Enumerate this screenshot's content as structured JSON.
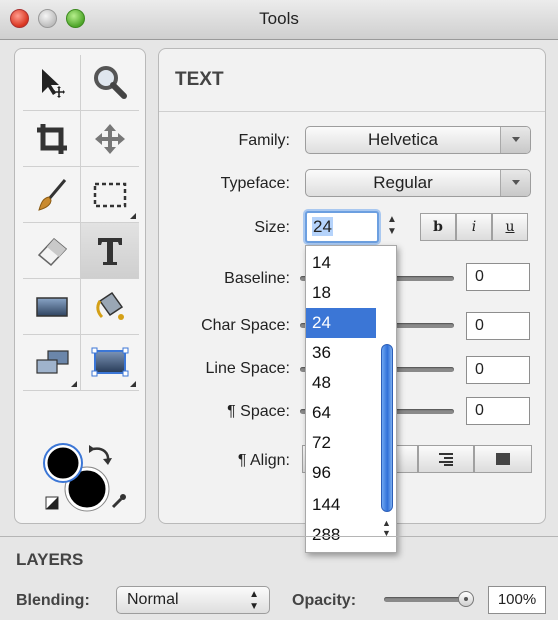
{
  "window": {
    "title": "Tools"
  },
  "tools": [
    {
      "name": "select",
      "icon": "arrow-move-icon"
    },
    {
      "name": "zoom",
      "icon": "magnifier-icon"
    },
    {
      "name": "crop",
      "icon": "crop-icon"
    },
    {
      "name": "move",
      "icon": "move-arrows-icon"
    },
    {
      "name": "brush",
      "icon": "brush-icon"
    },
    {
      "name": "marquee",
      "icon": "marquee-icon"
    },
    {
      "name": "eraser",
      "icon": "eraser-icon"
    },
    {
      "name": "text",
      "icon": "text-t-icon",
      "selected": true
    },
    {
      "name": "rectangle",
      "icon": "rectangle-icon"
    },
    {
      "name": "fill",
      "icon": "paint-bucket-icon"
    },
    {
      "name": "layers",
      "icon": "layer-stack-icon"
    },
    {
      "name": "selection-frame",
      "icon": "selection-frame-icon"
    }
  ],
  "colors": {
    "foreground": "#000000",
    "background": "#000000",
    "accent": "#3b76d6"
  },
  "text_panel": {
    "title": "TEXT",
    "family_label": "Family:",
    "family_value": "Helvetica",
    "typeface_label": "Typeface:",
    "typeface_value": "Regular",
    "size_label": "Size:",
    "size_value": "24",
    "bold_label": "b",
    "italic_label": "i",
    "underline_label": "u",
    "baseline_label": "Baseline:",
    "baseline_value": "0",
    "char_space_label": "Char Space:",
    "char_space_value": "0",
    "line_space_label": "Line Space:",
    "line_space_value": "0",
    "para_space_label": "¶ Space:",
    "para_space_value": "0",
    "align_label": "¶ Align:"
  },
  "size_dropdown": {
    "options": [
      "14",
      "18",
      "24",
      "36",
      "48",
      "64",
      "72",
      "96",
      "144",
      "288"
    ],
    "selected": "24"
  },
  "layers": {
    "title": "LAYERS",
    "blending_label": "Blending:",
    "blending_value": "Normal",
    "opacity_label": "Opacity:",
    "opacity_value": "100%"
  }
}
